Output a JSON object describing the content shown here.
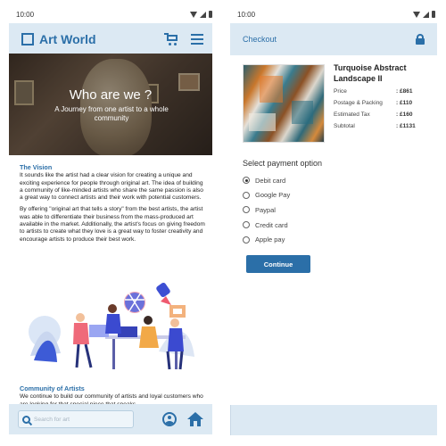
{
  "left": {
    "status": {
      "time": "10:00"
    },
    "appbar": {
      "brand": "Art World"
    },
    "hero": {
      "title": "Who are we ?",
      "subtitle": "A Journey from one artist to a whole community"
    },
    "vision": {
      "title": "The Vision",
      "p1": "It sounds like the artist had a clear vision for creating a unique and exciting experience for people through original art. The idea of building a community of like-minded artists who share the same passion is also a great way to connect artists and their work with potential customers.",
      "p2": "By offering \"original art that tells a story\" from the best artists, the artist was able to differentiate their business from the mass-produced art available in the market. Additionally, the artist's focus on giving freedom to artists to create what they love is a great way to foster creativity and encourage artists to produce their best work."
    },
    "community": {
      "title": "Community of Artists",
      "p1": "We continue to build our community of artists and loyal customers who are looking for that special piece that speaks"
    },
    "search": {
      "placeholder": "Search for art"
    }
  },
  "right": {
    "status": {
      "time": "10:00"
    },
    "appbar": {
      "title": "Checkout"
    },
    "product": {
      "name": "Turquoise Abstract Landscape II",
      "prices": [
        {
          "label": "Price",
          "value": ": £861"
        },
        {
          "label": "Postage & Packing",
          "value": ": £110"
        },
        {
          "label": "Estimated Tax",
          "value": ": £160"
        },
        {
          "label": "Subtotal",
          "value": ": £1131"
        }
      ]
    },
    "payment": {
      "title": "Select payment option",
      "options": [
        "Debit card",
        "Google Pay",
        "Paypal",
        "Credit card",
        "Apple pay"
      ],
      "selected": "Debit card"
    },
    "continue_label": "Continue"
  },
  "colors": {
    "accent": "#2b6fa8",
    "bar_bg": "#dce9f3"
  },
  "icons": [
    "cart-icon",
    "menu-icon",
    "search-icon",
    "profile-icon",
    "home-icon",
    "lock-icon"
  ]
}
